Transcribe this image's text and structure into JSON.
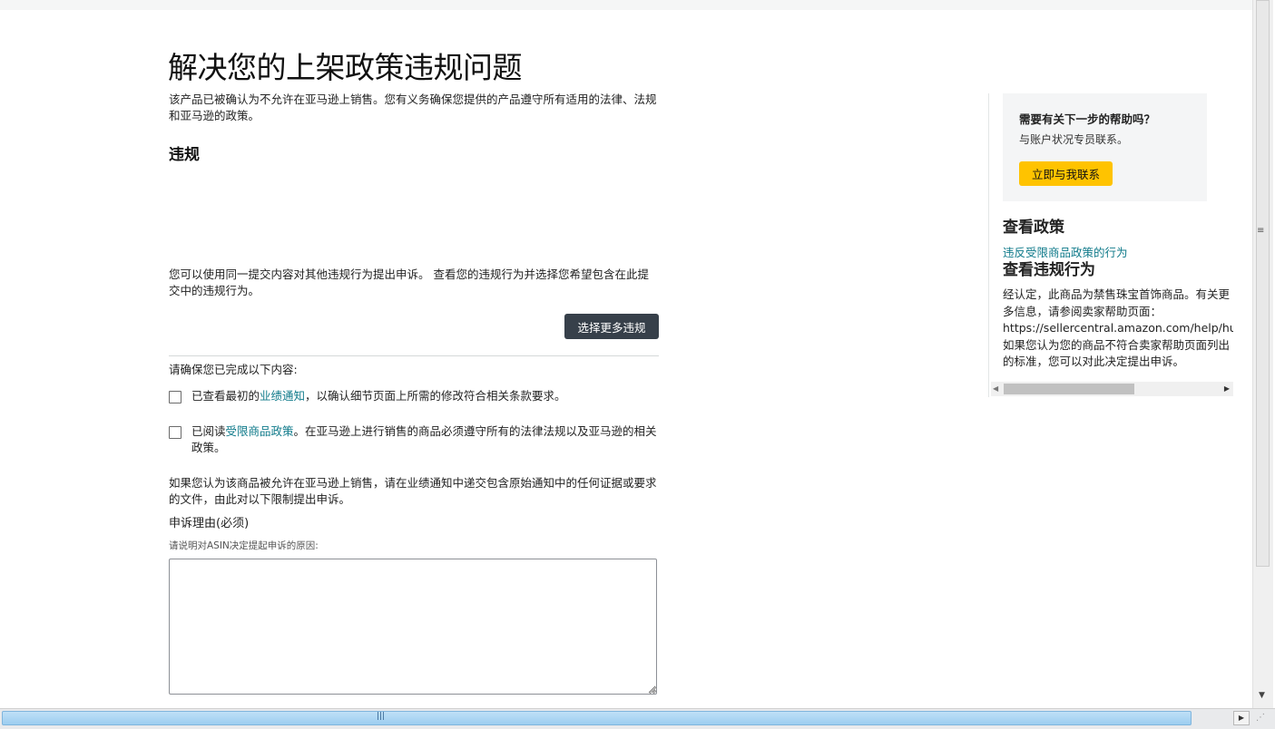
{
  "page": {
    "title": "解决您的上架政策违规问题",
    "intro": "该产品已被确认为不允许在亚马逊上销售。您有义务确保您提供的产品遵守所有适用的法律、法规和亚马逊的政策。"
  },
  "violations": {
    "heading": "违规",
    "appeal_more_text": "您可以使用同一提交内容对其他违规行为提出申诉。 查看您的违规行为并选择您希望包含在此提交中的违规行为。",
    "select_more_button": "选择更多违规"
  },
  "checklist": {
    "label": "请确保您已完成以下内容:",
    "items": [
      {
        "before": "已查看最初的",
        "link": "业绩通知",
        "after": "，以确认细节页面上所需的修改符合相关条款要求。"
      },
      {
        "before": "已阅读",
        "link": "受限商品政策",
        "after": "。在亚马逊上进行销售的商品必须遵守所有的法律法规以及亚马逊的相关政策。"
      }
    ]
  },
  "appeal": {
    "note": "如果您认为该商品被允许在亚马逊上销售，请在业绩通知中递交包含原始通知中的任何证据或要求的文件，由此对以下限制提出申诉。",
    "reason_label": "申诉理由(必须)",
    "reason_hint": "请说明对ASIN决定提起申诉的原因:",
    "reason_value": ""
  },
  "help": {
    "title": "需要有关下一步的帮助吗？",
    "subtitle": "与账户状况专员联系。",
    "contact_button": "立即与我联系"
  },
  "policy": {
    "heading": "查看政策",
    "link": "违反受限商品政策的行为"
  },
  "violation_review": {
    "heading": "查看违规行为",
    "lines": [
      "经认定，此商品为禁售珠宝首饰商品。有关更",
      "多信息，请参阅卖家帮助页面：",
      "https://sellercentral.amazon.com/help/hub/reference",
      "如果您认为您的商品不符合卖家帮助页面列出",
      "的标准，您可以对此决定提出申诉。"
    ]
  },
  "icons": {
    "arrow_left": "scroll-left-arrow-icon",
    "arrow_right": "scroll-right-arrow-icon",
    "arrow_down": "scroll-down-arrow-icon",
    "grip": "resize-grip-icon"
  },
  "colors": {
    "link": "#0f7a8a",
    "dark_button": "#37404a",
    "yellow_button": "#ffc300",
    "card_bg": "#f4f5f6"
  }
}
